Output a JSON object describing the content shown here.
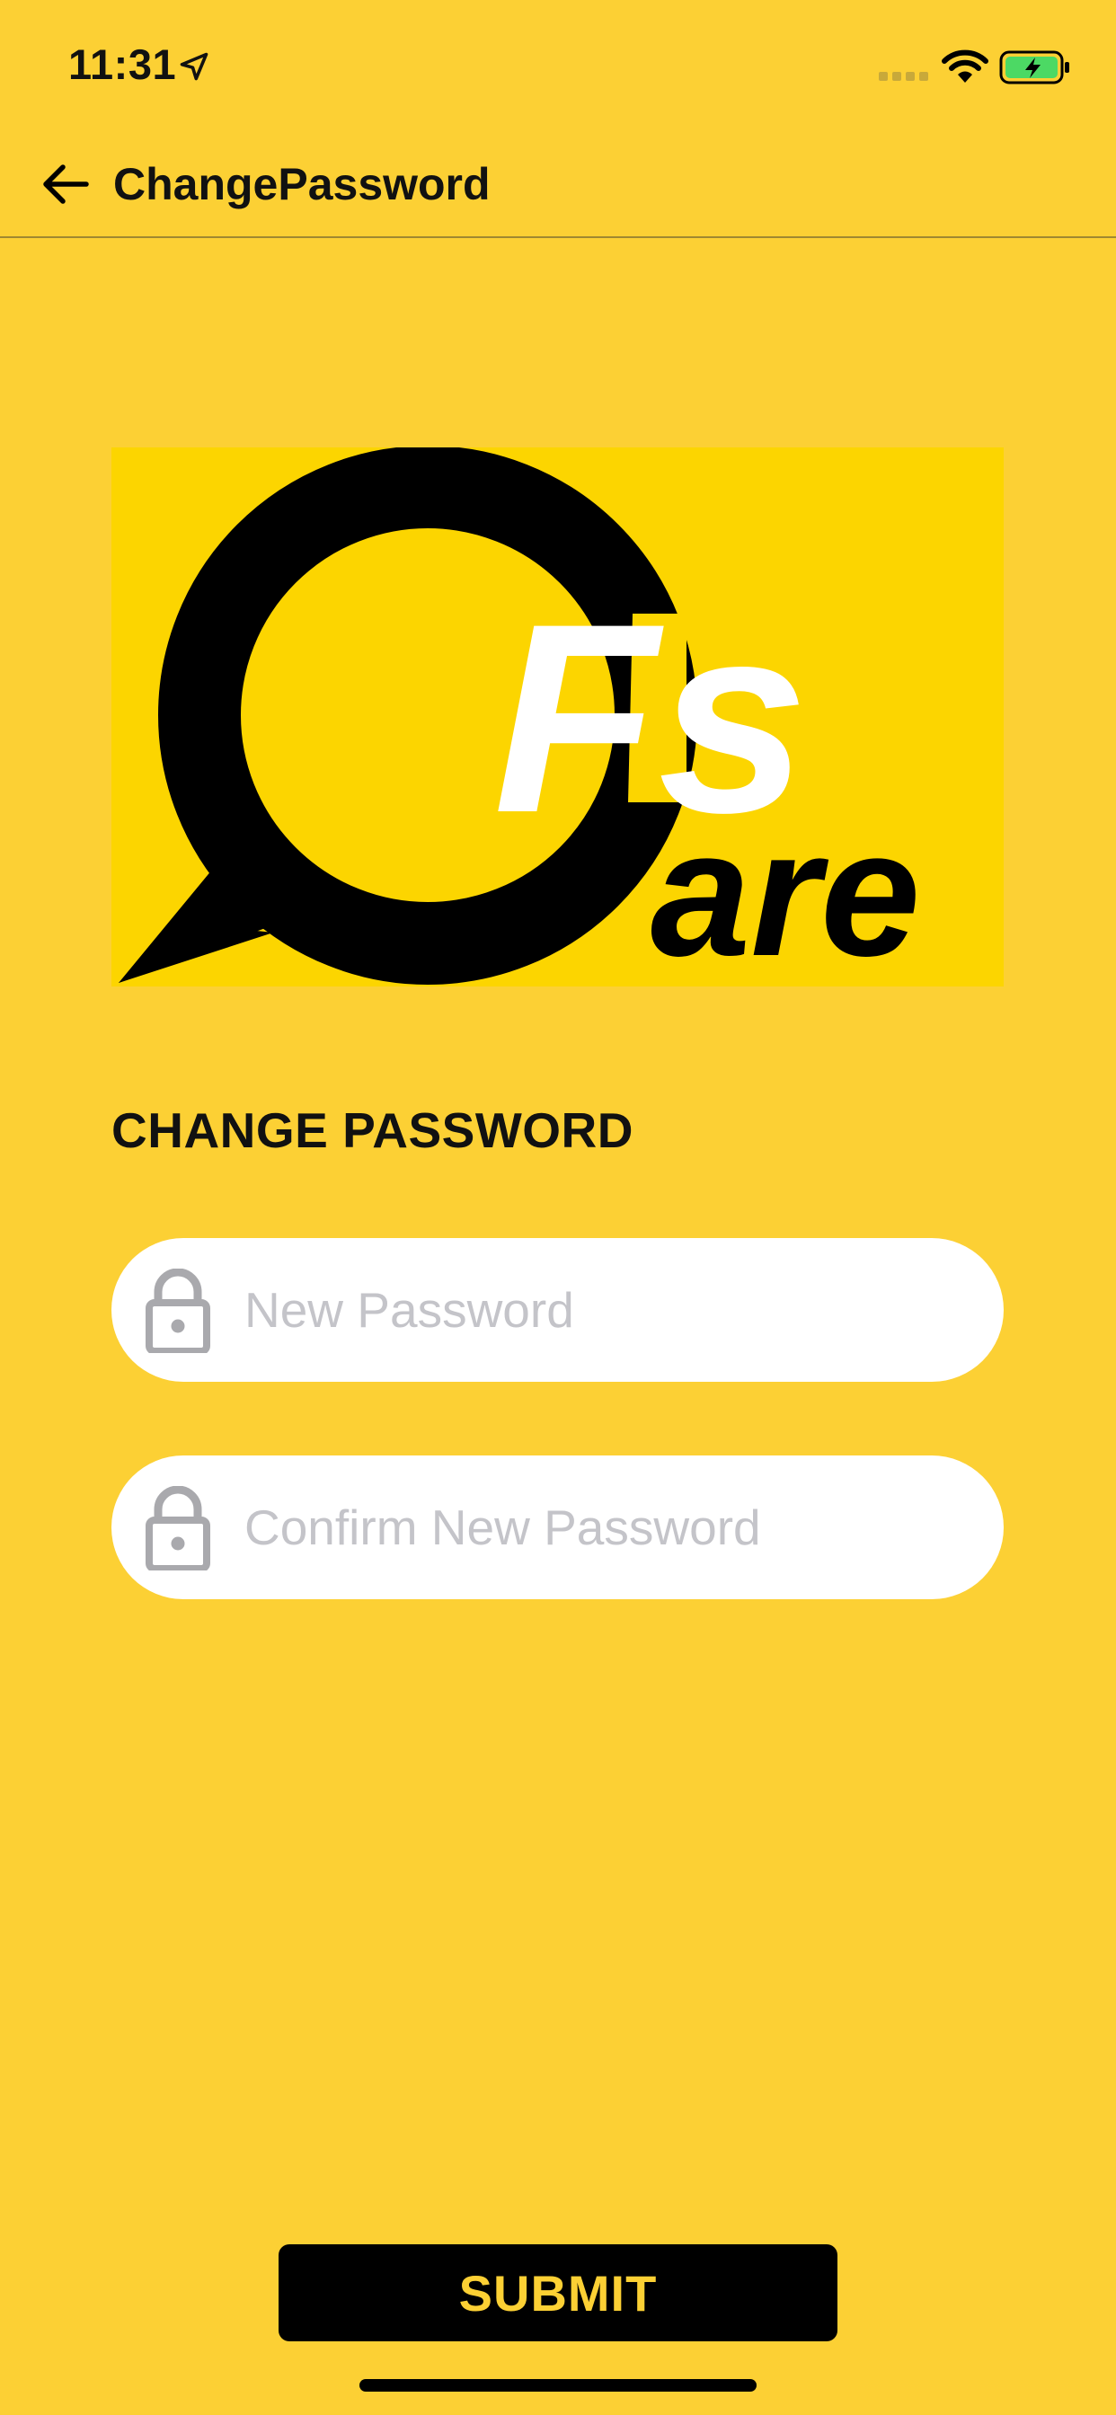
{
  "status_bar": {
    "time": "11:31",
    "icons": [
      "location-arrow-icon",
      "cellular-signal-icon",
      "wifi-icon",
      "battery-charging-icon"
    ]
  },
  "nav": {
    "title": "ChangePassword",
    "back_icon": "arrow-left-icon"
  },
  "logo": {
    "brand_top": "Fs",
    "brand_bottom": "are"
  },
  "form": {
    "heading": "CHANGE PASSWORD",
    "new_password": {
      "value": "",
      "placeholder": "New Password",
      "icon": "lock-icon"
    },
    "confirm_password": {
      "value": "",
      "placeholder": "Confirm New Password",
      "icon": "lock-icon"
    }
  },
  "submit_label": "SUBMIT",
  "colors": {
    "background": "#FCD034",
    "logo_background": "#FCD500",
    "button": "#000000",
    "button_text": "#FCD034",
    "placeholder": "#C4C4C9"
  }
}
